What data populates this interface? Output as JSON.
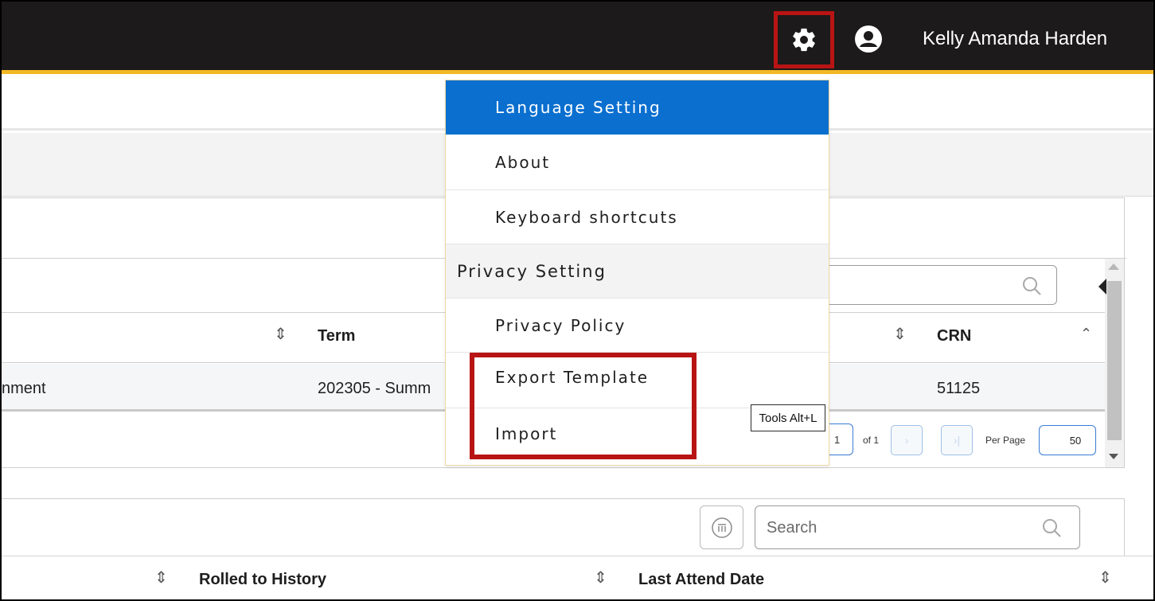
{
  "header": {
    "user_name": "Kelly Amanda Harden",
    "settings_icon": "gear-icon",
    "user_icon": "user-circle-icon"
  },
  "grid1": {
    "columns": [
      "Term",
      "CRN"
    ],
    "row": {
      "col0": "nment",
      "term": "202305 - Summ",
      "crn": "51125"
    },
    "pager": {
      "page": "1",
      "of_label": "of 1",
      "per_page_label": "Per Page",
      "per_page_value": "50"
    }
  },
  "grid2": {
    "search_placeholder": "Search",
    "columns": [
      "Rolled to History",
      "Last Attend Date"
    ]
  },
  "menu": {
    "items": [
      {
        "label": "Language Setting"
      },
      {
        "label": "About"
      },
      {
        "label": "Keyboard shortcuts"
      },
      {
        "label": "Privacy Setting"
      },
      {
        "label": "Privacy Policy"
      },
      {
        "label": "Export Template"
      },
      {
        "label": "Import"
      }
    ]
  },
  "tooltip": {
    "text": "Tools Alt+L"
  },
  "colors": {
    "header_bg": "#1c1a1a",
    "header_accent": "#f2b824",
    "menu_active": "#0a6fcf",
    "highlight": "#b81414"
  }
}
